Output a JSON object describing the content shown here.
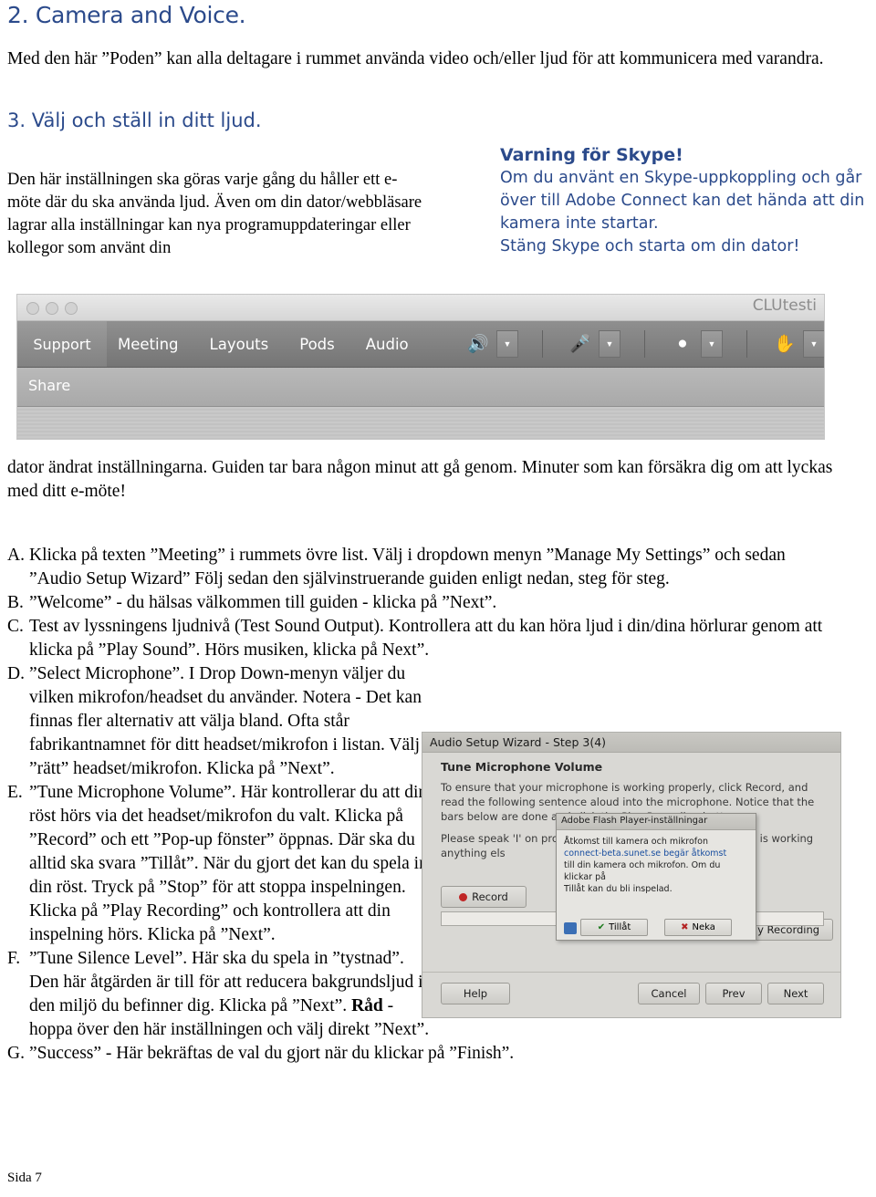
{
  "heading": {
    "section": "2. Camera and Voice.",
    "step": "3. Välj och ställ in ditt ljud."
  },
  "intro": "Med den här ”Poden” kan alla deltagare i rummet använda video och/eller ljud för att kommunicera med varandra.",
  "left_column": "Den här inställningen ska göras varje gång du håller ett e-möte där du ska använda ljud. Även om din dator/webbläsare lagrar alla inställningar kan nya programuppdateringar eller kollegor som använt din",
  "warning": {
    "title": "Varning för Skype!",
    "line1": "Om du använt en Skype-uppkoppling och går över till Adobe Connect kan det hända att din kamera inte startar.",
    "line2": "Stäng Skype och starta om din dator!"
  },
  "connect_shot": {
    "window_label": "CLUtesti",
    "support_tab": "Support",
    "menus": [
      "Meeting",
      "Layouts",
      "Pods",
      "Audio"
    ],
    "share_label": "Share",
    "tools": [
      "speaker-icon",
      "microphone-icon",
      "person-icon",
      "raise-hand-icon"
    ]
  },
  "after_shot": "dator ändrat inställningarna. Guiden tar bara någon minut att gå genom. Minuter som kan försäkra dig om att lyckas med ditt e-möte!",
  "steps": [
    {
      "letter": "A.",
      "text": "Klicka på texten ”Meeting” i rummets övre list. Välj i dropdown menyn ”Manage My Settings” och sedan ”Audio Setup Wizard” Följ sedan den självinstruerande guiden enligt nedan, steg för steg."
    },
    {
      "letter": "B.",
      "text": "”Welcome” - du hälsas välkommen till guiden - klicka på ”Next”."
    },
    {
      "letter": "C.",
      "text": "Test av lyssningens ljudnivå (Test Sound Output). Kontrollera att du kan höra ljud i din/dina hörlurar genom att klicka på ”Play Sound”. Hörs musiken, klicka på Next”."
    },
    {
      "letter": "D.",
      "text": "”Select Microphone”. I Drop Down-menyn väljer du vilken mikrofon/headset du använder. Notera - Det kan finnas fler alternativ att välja bland. Ofta står fabrikantnamnet för ditt headset/mikrofon i listan. Välj ”rätt” headset/mikrofon. Klicka på ”Next”."
    },
    {
      "letter": "E.",
      "text": "”Tune Microphone Volume”. Här kontrollerar du att din röst hörs via det headset/mikrofon du valt. Klicka på ”Record” och ett ”Pop-up fönster” öppnas. Där ska du alltid ska svara ”Tillåt”. När du gjort det kan du spela in din röst. Tryck på ”Stop” för att stoppa inspelningen. Klicka på ”Play Recording” och kontrollera att din inspelning hörs. Klicka på ”Next”."
    },
    {
      "letter": "F.",
      "text": "”Tune Silence Level”. Här ska du spela in ”tystnad”. Den här åtgärden är till för att reducera bakgrundsljud i den miljö du befinner dig. Klicka på ”Next”.",
      "bold_tail": "Råd",
      "tail": " - hoppa över den här inställningen och välj direkt ”Next”."
    },
    {
      "letter": "G.",
      "text": "”Success” - Här bekräftas de val du gjort när du klickar på ”Finish”."
    }
  ],
  "wizard": {
    "title": "Audio Setup Wizard - Step 3(4)",
    "subtitle": "Tune Microphone Volume",
    "description": "To ensure that your microphone is working properly, click Record, and read the following sentence aloud into the microphone. Notice that the bars below are done and click the Play Recording button.",
    "speak_label": "Please speak 'I' on properly' or anything els",
    "working_label": "phone is working",
    "record_button": "Record",
    "play_recording_button": "Play Recording",
    "help_button": "Help",
    "cancel_button": "Cancel",
    "prev_button": "Prev",
    "next_button": "Next",
    "popup": {
      "title": "Adobe Flash Player-inställningar",
      "body_line1": "Åtkomst till kamera och mikrofon",
      "body_link": "connect-beta.sunet.se begär åtkomst",
      "body_line2": "till din kamera och mikrofon. Om du klickar på",
      "body_line3": "Tillåt kan du bli inspelad.",
      "allow_button": "Tillåt",
      "deny_button": "Neka"
    }
  },
  "footer": "Sida 7"
}
